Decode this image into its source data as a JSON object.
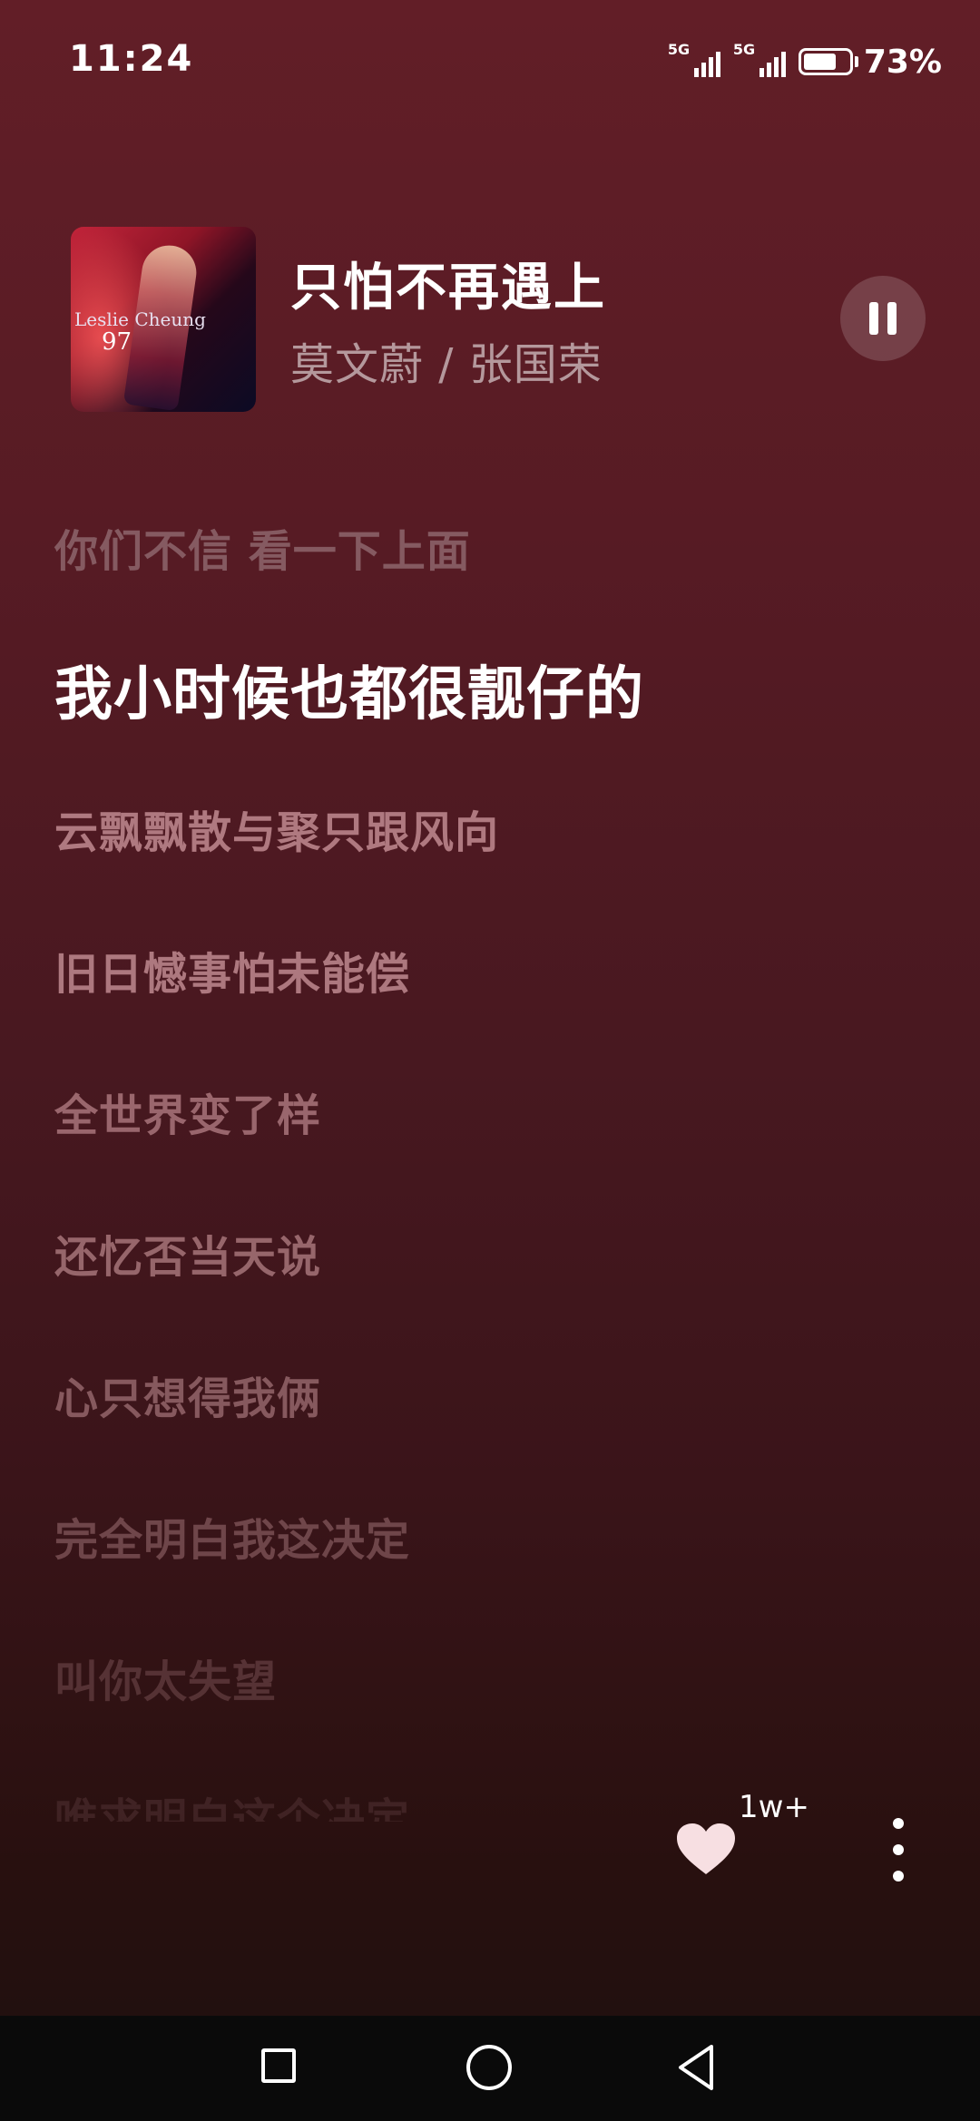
{
  "status_bar": {
    "time": "11:24",
    "signal1_label": "5G",
    "signal2_label": "5G",
    "battery_percent": "73%",
    "battery_level": 0.73
  },
  "now_playing": {
    "title": "只怕不再遇上",
    "artist": "莫文蔚 / 张国荣",
    "album_art_text": "Leslie Cheung",
    "album_art_number": "97",
    "is_playing": true
  },
  "lyrics": {
    "past": "你们不信 看一下上面",
    "current": "我小时候也都很靓仔的",
    "upcoming": [
      "云飘飘散与聚只跟风向",
      "旧日憾事怕未能偿",
      "全世界变了样",
      "还忆否当天说",
      "心只想得我俩",
      "完全明白我这决定",
      "叫你太失望",
      "唯求明白这个决定"
    ]
  },
  "actions": {
    "like_count": "1w+"
  },
  "colors": {
    "background_top": "#621e27",
    "background_bottom": "#22100f",
    "nav_bar": "#0a0a0a"
  }
}
